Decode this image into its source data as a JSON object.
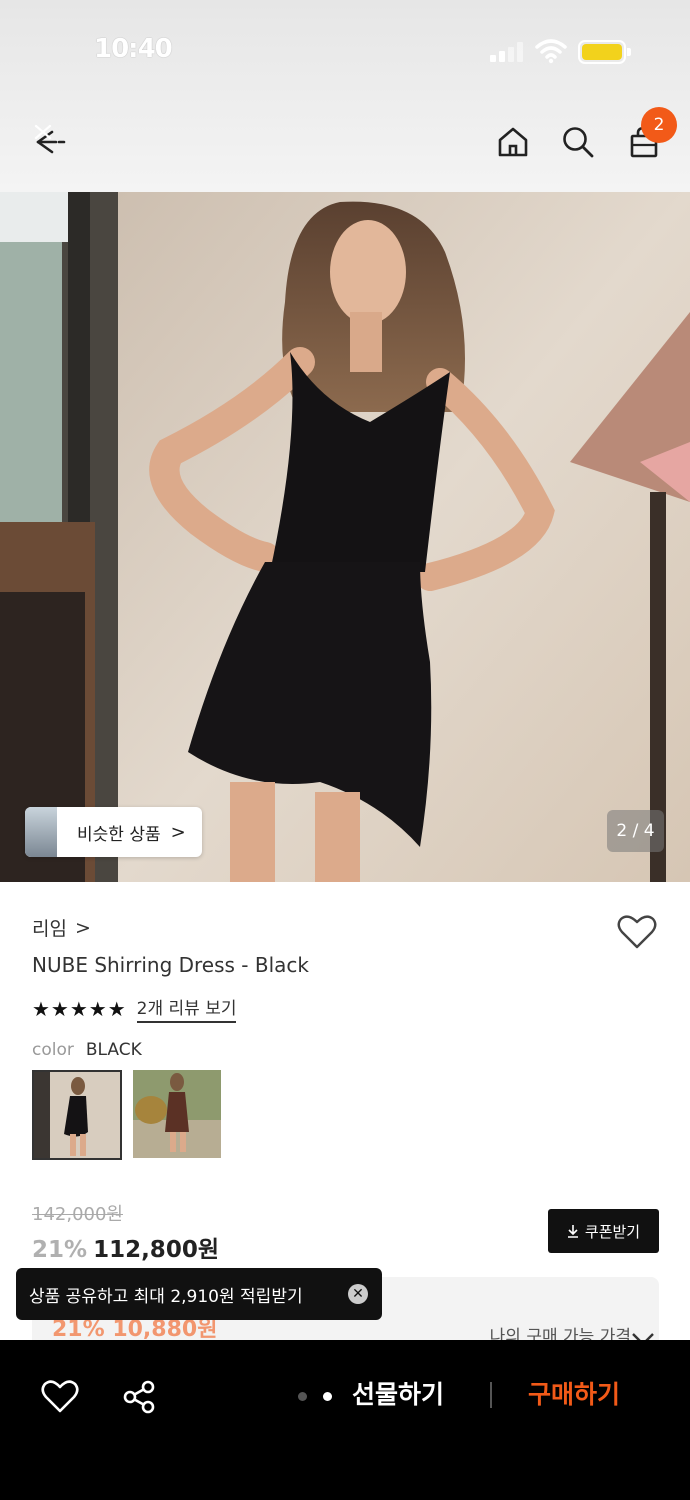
{
  "status_bar": {
    "time": "10:40"
  },
  "header": {
    "cart_count": "2"
  },
  "gallery": {
    "similar_label": "비슷한 상품",
    "chevron": ">",
    "pager": "2 / 4"
  },
  "product": {
    "brand": "리임",
    "brand_chevron": ">",
    "name": "NUBE Shirring Dress - Black",
    "stars": "★★★★★",
    "rating": 5,
    "review_link": "2개 리뷰 보기",
    "color_key": "color",
    "color_value": "BLACK"
  },
  "price": {
    "original": "142,000원",
    "discount": "21%",
    "sale": "112,800원",
    "coupon_label": "쿠폰받기",
    "my_price_label": "나의 구매 가능 가격",
    "my_price_partial": "21% 10,880원"
  },
  "toast": {
    "message": "상품 공유하고 최대 2,910원 적립받기",
    "close": "✕"
  },
  "bottom_bar": {
    "gift_label": "선물하기",
    "buy_label": "구매하기"
  },
  "colors": {
    "accent": "#f25a18",
    "dark": "#111111"
  }
}
